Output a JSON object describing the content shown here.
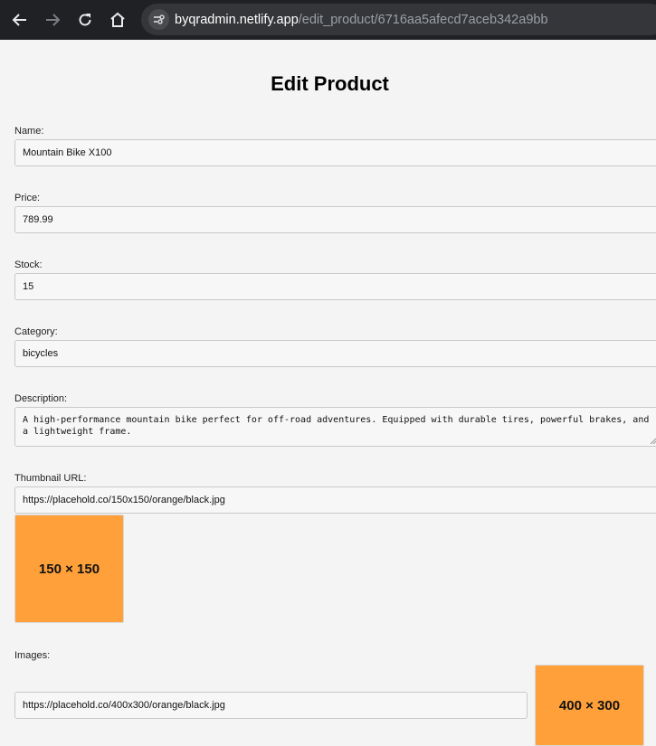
{
  "browser": {
    "url_host": "byqradmin.netlify.app",
    "url_path": "/edit_product/6716aa5afecd7aceb342a9bb"
  },
  "page": {
    "title": "Edit Product"
  },
  "form": {
    "name": {
      "label": "Name:",
      "value": "Mountain Bike X100"
    },
    "price": {
      "label": "Price:",
      "value": "789.99"
    },
    "stock": {
      "label": "Stock:",
      "value": "15"
    },
    "category": {
      "label": "Category:",
      "value": "bicycles"
    },
    "description": {
      "label": "Description:",
      "value": "A high-performance mountain bike perfect for off-road adventures. Equipped with durable tires, powerful brakes, and a lightweight frame."
    },
    "thumbnail": {
      "label": "Thumbnail URL:",
      "value": "https://placehold.co/150x150/orange/black.jpg",
      "preview_text": "150 × 150"
    },
    "images": {
      "label": "Images:",
      "items": [
        {
          "value": "https://placehold.co/400x300/orange/black.jpg",
          "preview_text": "400 × 300"
        }
      ]
    }
  },
  "colors": {
    "placeholder_orange": "#ffa03a",
    "browser_chrome": "#202124"
  }
}
